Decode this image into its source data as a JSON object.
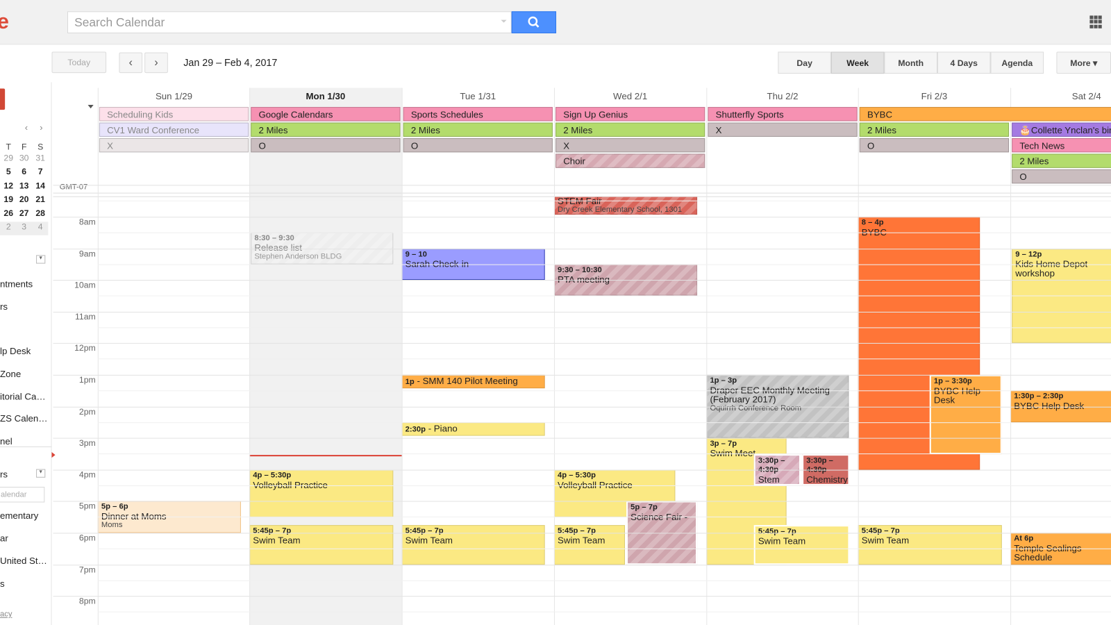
{
  "header": {
    "logo_fragment": "e",
    "search_placeholder": "Search Calendar",
    "search_icon": "search-icon",
    "apps_icon": "apps-grid-icon"
  },
  "toolbar": {
    "today": "Today",
    "prev": "‹",
    "next": "›",
    "date_range": "Jan 29 – Feb 4, 2017",
    "views": [
      {
        "label": "Day"
      },
      {
        "label": "Week",
        "selected": true
      },
      {
        "label": "Month"
      },
      {
        "label": "4 Days"
      },
      {
        "label": "Agenda"
      }
    ],
    "more": "More ▾"
  },
  "sidebar": {
    "mini_calendar": {
      "nav_prev": "‹",
      "nav_next": "›",
      "weekday_headers": [
        "T",
        "F",
        "S"
      ],
      "rows": [
        [
          "29",
          "30",
          "31"
        ],
        [
          "5",
          "6",
          "7"
        ],
        [
          "12",
          "13",
          "14"
        ],
        [
          "19",
          "20",
          "21"
        ],
        [
          "26",
          "27",
          "28"
        ],
        [
          "2",
          "3",
          "4"
        ]
      ]
    },
    "my_calendars": [
      "ntments",
      "rs",
      "lp Desk",
      "Zone",
      "itorial Ca…",
      "ZS Calen…",
      "nel"
    ],
    "other_header": "rs",
    "add_placeholder": "alendar",
    "other_calendars": [
      "ementary",
      "ar",
      "United St…",
      "s"
    ],
    "footer_link": "acy"
  },
  "days": [
    {
      "label": "Sun 1/29"
    },
    {
      "label": "Mon 1/30",
      "today": true
    },
    {
      "label": "Tue 1/31"
    },
    {
      "label": "Wed 2/1"
    },
    {
      "label": "Thu 2/2"
    },
    {
      "label": "Fri 2/3"
    },
    {
      "label": "Sat 2/4"
    }
  ],
  "timezone": "GMT-07",
  "hours": [
    "8am",
    "9am",
    "10am",
    "11am",
    "12pm",
    "1pm",
    "2pm",
    "3pm",
    "4pm",
    "5pm",
    "6pm",
    "7pm",
    "8pm"
  ],
  "all_day": [
    {
      "day": 0,
      "row": 0,
      "title": "Scheduling Kids",
      "color": "#fde0ea",
      "faded": true
    },
    {
      "day": 0,
      "row": 1,
      "title": "CV1 Ward Conference",
      "color": "#e8e4fb",
      "faded": true
    },
    {
      "day": 0,
      "row": 2,
      "title": "X",
      "color": "#ebe6e7",
      "faded": true
    },
    {
      "day": 1,
      "row": 0,
      "title": "Google Calendars",
      "color": "#f691b2"
    },
    {
      "day": 1,
      "row": 1,
      "title": "2 Miles",
      "color": "#b3dc6c"
    },
    {
      "day": 1,
      "row": 2,
      "title": "O",
      "color": "#cabdbf"
    },
    {
      "day": 2,
      "row": 0,
      "title": "Sports Schedules",
      "color": "#f691b2"
    },
    {
      "day": 2,
      "row": 1,
      "title": "2 Miles",
      "color": "#b3dc6c"
    },
    {
      "day": 2,
      "row": 2,
      "title": "O",
      "color": "#cabdbf"
    },
    {
      "day": 3,
      "row": 0,
      "title": "Sign Up Genius",
      "color": "#f691b2"
    },
    {
      "day": 3,
      "row": 1,
      "title": "2 Miles",
      "color": "#b3dc6c"
    },
    {
      "day": 3,
      "row": 2,
      "title": "X",
      "color": "#cabdbf"
    },
    {
      "day": 3,
      "row": 3,
      "title": "Choir",
      "color": "#d6a9b2",
      "striped": true
    },
    {
      "day": 4,
      "row": 0,
      "title": "Shutterfly Sports",
      "color": "#f691b2"
    },
    {
      "day": 4,
      "row": 1,
      "title": "X",
      "color": "#cabdbf"
    },
    {
      "day": 5,
      "row": 0,
      "title": "BYBC",
      "color": "#ffad46",
      "span": 2
    },
    {
      "day": 5,
      "row": 1,
      "title": "2 Miles",
      "color": "#b3dc6c"
    },
    {
      "day": 5,
      "row": 2,
      "title": "O",
      "color": "#cabdbf"
    },
    {
      "day": 6,
      "row": 1,
      "title": "Collette Ynclan's birthday",
      "color": "#a47ae2",
      "icon": "birthday-cake-icon"
    },
    {
      "day": 6,
      "row": 2,
      "title": "Tech News",
      "color": "#f691b2"
    },
    {
      "day": 6,
      "row": 3,
      "title": "2 Miles",
      "color": "#b3dc6c"
    },
    {
      "day": 6,
      "row": 4,
      "title": "O",
      "color": "#cabdbf"
    }
  ],
  "events": [
    {
      "day": 3,
      "start": 7.3,
      "end": 7.93,
      "time": "",
      "title": "STEM Fair",
      "location": "Dry Creek Elementary School, 1301",
      "color": "#d9645a",
      "striped": true
    },
    {
      "day": 1,
      "start": 8.5,
      "end": 9.5,
      "time": "8:30 – 9:30",
      "title": "Release list",
      "location": "Stephen Anderson BLDG",
      "color": "#eeeeee",
      "striped": true,
      "faded": true
    },
    {
      "day": 2,
      "start": 9,
      "end": 10,
      "time": "9 – 10",
      "title": "Sarah Check-in",
      "color": "#9a9cff",
      "border": "#3b46b5"
    },
    {
      "day": 3,
      "start": 9.5,
      "end": 10.5,
      "time": "9:30 – 10:30",
      "title": "PTA meeting",
      "color": "#cfa5ad",
      "striped": true
    },
    {
      "day": 5,
      "start": 8,
      "end": 16,
      "time": "8 – 4p",
      "title": "BYBC",
      "color": "#ff7537"
    },
    {
      "day": 6,
      "start": 9,
      "end": 12,
      "time": "9 – 12p",
      "title": "Kids Home Depot workshop",
      "color": "#fbe983"
    },
    {
      "day": 2,
      "start": 13,
      "end": 13.42,
      "time": "1p",
      "title": "- SMM 140 Pilot Meeting",
      "color": "#ffad46",
      "inline": true
    },
    {
      "day": 2,
      "start": 14.5,
      "end": 14.92,
      "time": "2:30p",
      "title": "- Piano",
      "color": "#fbe983",
      "inline": true
    },
    {
      "day": 4,
      "start": 13,
      "end": 15,
      "time": "1p – 3p",
      "title": "Draper EEC Monthly Meeting (February 2017)",
      "location": "Oquirrh Conference Room",
      "color": "#c2c2c2",
      "striped": true
    },
    {
      "day": 5,
      "start": 13,
      "end": 15.5,
      "time": "1p – 3:30p",
      "title": "BYBC Help Desk",
      "color": "#ffad46",
      "white_border": true
    },
    {
      "day": 6,
      "start": 13.5,
      "end": 14.5,
      "time": "1:30p – 2:30p",
      "title": "BYBC Help Desk",
      "color": "#ffad46"
    },
    {
      "day": 4,
      "start": 15,
      "end": 19,
      "time": "3p – 7p",
      "title": "Swim Meet",
      "color": "#fbe983"
    },
    {
      "day": 4,
      "start": 15.5,
      "end": 16.5,
      "time": "3:30p – 4:30p",
      "title": "Stem Club",
      "color": "#d6a9b8",
      "striped": true,
      "white_border": true
    },
    {
      "day": 4,
      "start": 15.5,
      "end": 16.5,
      "time": "3:30p – 4:30p",
      "title": "Chemistry",
      "color": "#d06b64",
      "white_border": true
    },
    {
      "day": 1,
      "start": 16,
      "end": 17.5,
      "time": "4p – 5:30p",
      "title": "Volleyball Practice",
      "color": "#fbe983"
    },
    {
      "day": 3,
      "start": 16,
      "end": 17.5,
      "time": "4p – 5:30p",
      "title": "Volleyball Practice",
      "color": "#fbe983"
    },
    {
      "day": 0,
      "start": 17,
      "end": 18,
      "time": "5p – 6p",
      "title": "Dinner at Moms",
      "location": "Moms",
      "color": "#fde9cf",
      "border": "#f2c48a"
    },
    {
      "day": 3,
      "start": 17,
      "end": 19,
      "time": "5p – 7p",
      "title": "Science Fair -",
      "color": "#cfa5ad",
      "striped": true,
      "white_border": true
    },
    {
      "day": 1,
      "start": 17.75,
      "end": 19,
      "time": "5:45p – 7p",
      "title": "Swim Team",
      "color": "#fbe983"
    },
    {
      "day": 2,
      "start": 17.75,
      "end": 19,
      "time": "5:45p – 7p",
      "title": "Swim Team",
      "color": "#fbe983"
    },
    {
      "day": 3,
      "start": 17.75,
      "end": 19,
      "time": "5:45p – 7p",
      "title": "Swim Team",
      "color": "#fbe983"
    },
    {
      "day": 4,
      "start": 17.75,
      "end": 19,
      "time": "5:45p – 7p",
      "title": "Swim Team",
      "color": "#fbe983",
      "white_border": true
    },
    {
      "day": 5,
      "start": 17.75,
      "end": 19,
      "time": "5:45p – 7p",
      "title": "Swim Team",
      "color": "#fbe983"
    },
    {
      "day": 6,
      "start": 18,
      "end": 19,
      "time": "At 6p",
      "title": "Temple Sealings Schedule",
      "color": "#ffad46"
    }
  ],
  "current_time": 15.53,
  "colors": {
    "accent": "#4d90fe",
    "now_line": "#db4437",
    "today_bg": "#f1f1f1"
  }
}
